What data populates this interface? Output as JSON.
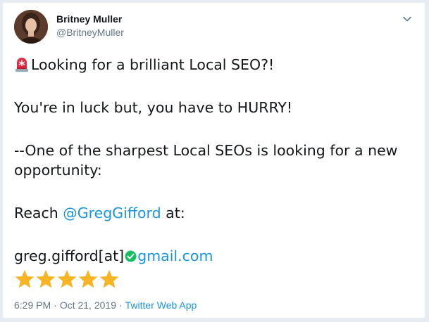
{
  "author": {
    "display_name": "Britney Muller",
    "handle": "@BritneyMuller"
  },
  "menu": {
    "caret_icon": "chevron-down-icon"
  },
  "tweet": {
    "line1_text": "Looking for a brilliant Local SEO?!",
    "line1_emoji": "police-light-icon",
    "line2_text": "You're in luck but, you have to HURRY!",
    "line3_text": "--One of the sharpest Local SEOs is looking for a new",
    "line4_text": "opportunity:",
    "line5_prefix": "Reach ",
    "line5_mention": "@GregGifford",
    "line5_suffix": " at:",
    "line6_prefix": "greg.gifford[at]",
    "line6_check_icon": "check-circle-icon",
    "line6_link": "gmail.com",
    "stars": [
      "star-icon",
      "star-icon",
      "star-icon",
      "star-icon",
      "star-icon"
    ]
  },
  "meta": {
    "time": "6:29 PM",
    "date": "Oct 21, 2019",
    "separator": "·",
    "source": "Twitter Web App"
  },
  "colors": {
    "link": "#1b95e0",
    "secondary_text": "#657786",
    "star": "#f7b526",
    "check": "#17bf63"
  }
}
